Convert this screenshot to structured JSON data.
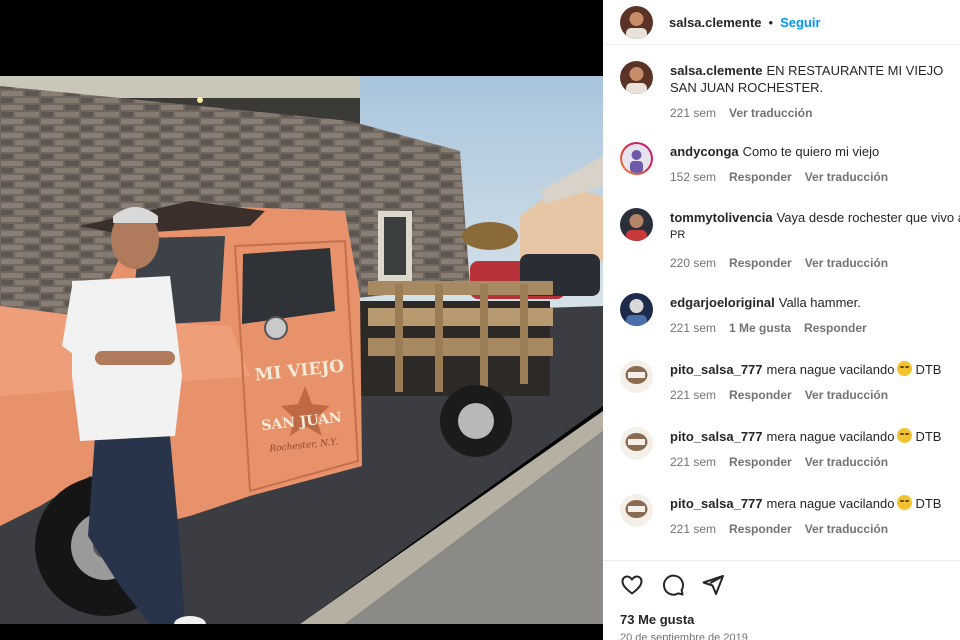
{
  "post": {
    "author": "salsa.clemente",
    "follow_label": "Seguir",
    "separator": "•",
    "photo_sign": {
      "line1": "MI VIEJO",
      "line2": "SAN JUAN",
      "line3": "Rochester, N.Y."
    }
  },
  "caption": {
    "username": "salsa.clemente",
    "text": "EN RESTAURANTE MI VIEJO SAN JUAN ROCHESTER.",
    "time": "221 sem",
    "translate": "Ver traducción"
  },
  "comments": [
    {
      "username": "andyconga",
      "text": "Como te quiero mi viejo",
      "time": "152 sem",
      "likes": "",
      "reply": "Responder",
      "translate": "Ver traducción"
    },
    {
      "username": "tommytolivencia",
      "text": "Vaya desde rochester que vivo aquí",
      "text2": "PR",
      "time": "220 sem",
      "likes": "",
      "reply": "Responder",
      "translate": "Ver traducción"
    },
    {
      "username": "edgarjoeloriginal",
      "text": "Valla hammer.",
      "time": "221 sem",
      "likes": "1 Me gusta",
      "reply": "Responder",
      "translate": ""
    },
    {
      "username": "pito_salsa_777",
      "text": "mera nague vacilando",
      "suffix": "DTB",
      "time": "221 sem",
      "likes": "",
      "reply": "Responder",
      "translate": "Ver traducción"
    },
    {
      "username": "pito_salsa_777",
      "text": "mera nague vacilando",
      "suffix": "DTB",
      "time": "221 sem",
      "likes": "",
      "reply": "Responder",
      "translate": "Ver traducción"
    },
    {
      "username": "pito_salsa_777",
      "text": "mera nague vacilando",
      "suffix": "DTB",
      "time": "221 sem",
      "likes": "",
      "reply": "Responder",
      "translate": "Ver traducción"
    }
  ],
  "footer": {
    "likes": "73 Me gusta",
    "date": "20 de septiembre de 2019"
  },
  "icons": {
    "like": "heart-icon",
    "comment": "comment-icon",
    "share": "share-icon"
  },
  "colors": {
    "accent": "#0095f6",
    "truck": "#e8926c",
    "text_secondary": "#737373"
  }
}
